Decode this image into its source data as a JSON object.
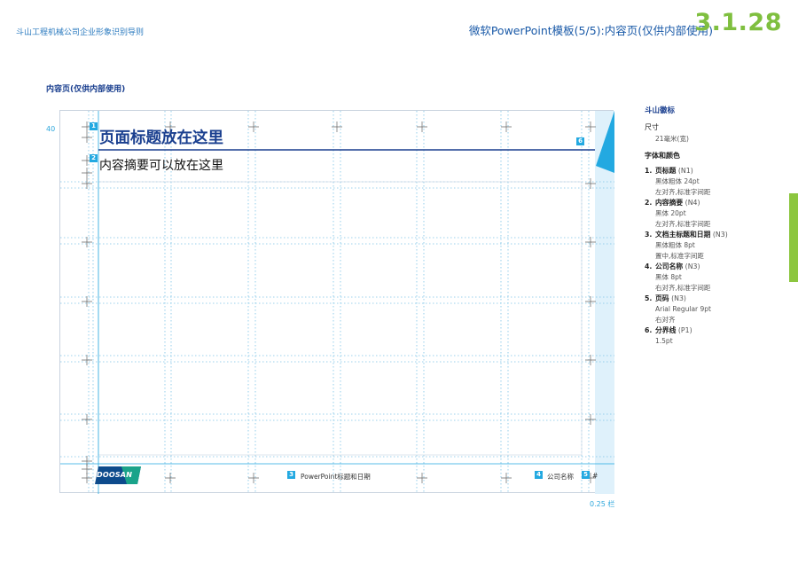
{
  "header": {
    "doc_title": "斗山工程机械公司企业形象识别导则",
    "section_title": "微软PowerPoint模板(5/5):内容页(仅供内部使用)",
    "page_number": "3.1.28"
  },
  "section_label": "内容页(仅供内部使用)",
  "mockup": {
    "slide_title": "页面标题放在这里",
    "slide_summary": "内容摘要可以放在这里",
    "dim_label": "40",
    "column_label": "0.25 栏",
    "footer_center": "PowerPoint标题和日期",
    "footer_company": "公司名称",
    "footer_page": "#",
    "logo_text": "DOOSAN",
    "badges": [
      "1",
      "2",
      "3",
      "4",
      "5",
      "6"
    ],
    "colors": {
      "accent": "#23a9e1",
      "title": "#1a3f8f",
      "triangle": "#23a9e1",
      "light_panel": "#dff1fb"
    }
  },
  "sidebar": {
    "heading": "斗山徽标",
    "size_label": "尺寸",
    "size_value": "21毫米(宽)",
    "fonts_label": "字体和颜色",
    "items": [
      {
        "n": "1.",
        "name": "页标题",
        "code": "(N1)",
        "lines": [
          "黑体粗体 24pt",
          "左对齐,标准字间距"
        ]
      },
      {
        "n": "2.",
        "name": "内容摘要",
        "code": "(N4)",
        "lines": [
          "黑体 20pt",
          "左对齐,标准字间距"
        ]
      },
      {
        "n": "3.",
        "name": "文档主标题和日期",
        "code": "(N3)",
        "lines": [
          "黑体粗体 8pt",
          "置中,标准字间距"
        ]
      },
      {
        "n": "4.",
        "name": "公司名称",
        "code": "(N3)",
        "lines": [
          "黑体 8pt",
          "右对齐,标准字间距"
        ]
      },
      {
        "n": "5.",
        "name": "页码",
        "code": "(N3)",
        "lines": [
          "Arial Regular 9pt",
          "右对齐"
        ]
      },
      {
        "n": "6.",
        "name": "分界线",
        "code": "(P1)",
        "lines": [
          "1.5pt"
        ]
      }
    ]
  }
}
